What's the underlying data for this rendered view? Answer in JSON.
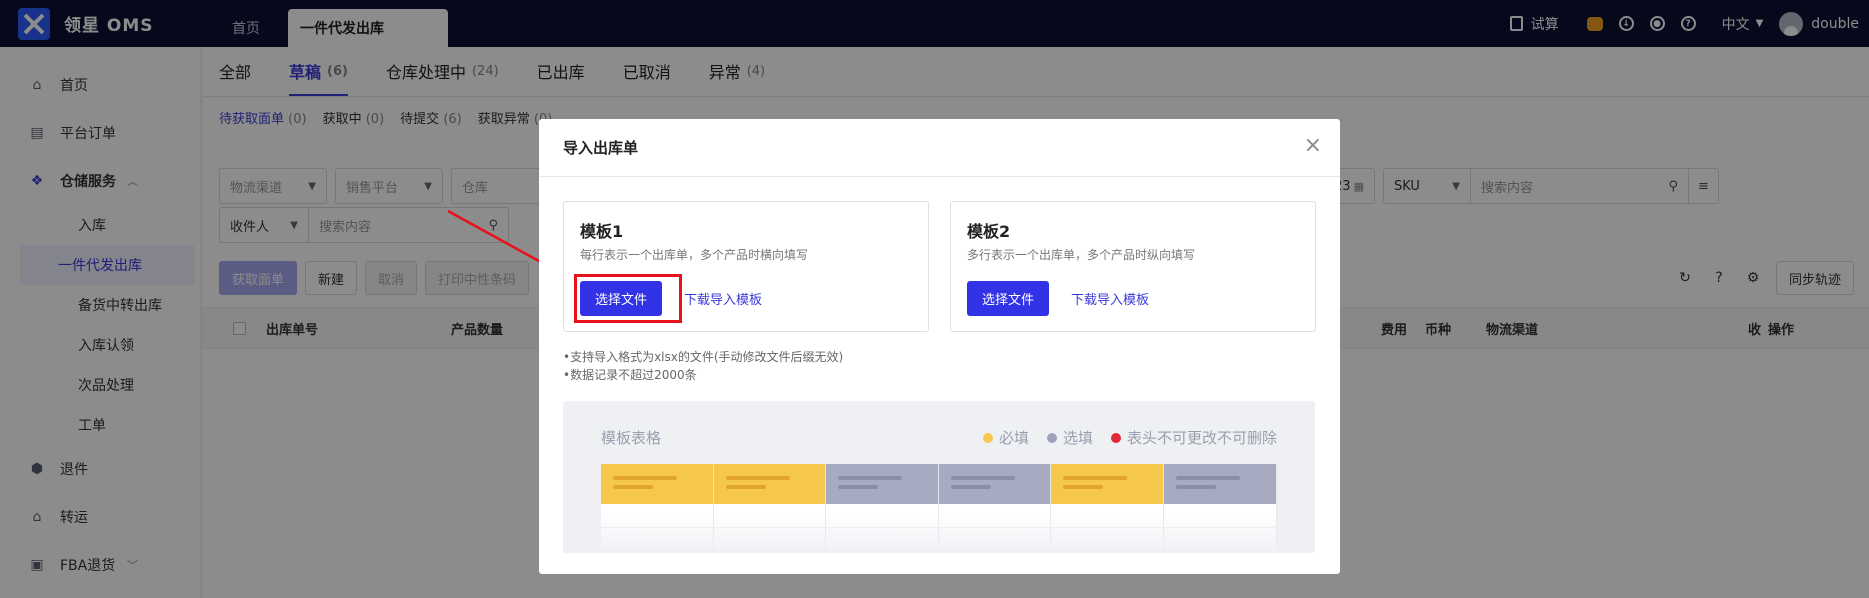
{
  "app": {
    "name": "领星 OMS",
    "user": "double",
    "language": "中文",
    "trial": "试算"
  },
  "top_tabs": [
    {
      "label": "首页"
    },
    {
      "label": "一件代发出库"
    }
  ],
  "sidebar": {
    "items": [
      {
        "label": "首页",
        "icon": "home-icon"
      },
      {
        "label": "平台订单",
        "icon": "order-icon"
      },
      {
        "label": "仓储服务",
        "icon": "warehouse-icon"
      },
      {
        "label": "退件",
        "icon": "return-icon"
      },
      {
        "label": "转运",
        "icon": "transfer-icon"
      },
      {
        "label": "FBA退货",
        "icon": "fba-icon"
      }
    ],
    "sub_items": [
      "入库",
      "一件代发出库",
      "备货中转出库",
      "入库认领",
      "次品处理",
      "工单"
    ]
  },
  "status_tabs": [
    {
      "label": "全部",
      "count": ""
    },
    {
      "label": "草稿",
      "count": "(6)"
    },
    {
      "label": "仓库处理中",
      "count": "(24)"
    },
    {
      "label": "已出库",
      "count": ""
    },
    {
      "label": "已取消",
      "count": ""
    },
    {
      "label": "异常",
      "count": "(4)"
    }
  ],
  "sub_tabs": [
    {
      "label": "待获取面单",
      "count": "(0)"
    },
    {
      "label": "获取中",
      "count": "(0)"
    },
    {
      "label": "待提交",
      "count": "(6)"
    },
    {
      "label": "获取异常",
      "count": "(0)"
    }
  ],
  "filters": {
    "logistics": "物流渠道",
    "platform": "销售平台",
    "warehouse": "仓库",
    "date_tail": "23",
    "sku": "SKU",
    "search_placeholder": "搜索内容",
    "receiver": "收件人"
  },
  "toolbar": {
    "get_label": "获取面单",
    "new": "新建",
    "cancel": "取消",
    "print": "打印中性条码",
    "sync": "同步轨迹"
  },
  "table_headers": {
    "order_no": "出库单号",
    "product_qty": "产品数量",
    "fee": "费用",
    "currency": "币种",
    "logistics": "物流渠道",
    "col_short": "收",
    "action": "操作"
  },
  "modal": {
    "title": "导入出库单",
    "templates": [
      {
        "name": "模板1",
        "desc": "每行表示一个出库单，多个产品时横向填写",
        "choose": "选择文件",
        "download": "下载导入模板"
      },
      {
        "name": "模板2",
        "desc": "多行表示一个出库单，多个产品时纵向填写",
        "choose": "选择文件",
        "download": "下载导入模板"
      }
    ],
    "notes": [
      "•支持导入格式为xlsx的文件(手动修改文件后缀无效)",
      "•数据记录不超过2000条"
    ],
    "preview": {
      "title": "模板表格",
      "legend": [
        {
          "label": "必填",
          "color": "#f5c84c"
        },
        {
          "label": "选填",
          "color": "#9ea2b8"
        },
        {
          "label": "表头不可更改不可删除",
          "color": "#e0283a"
        }
      ],
      "columns": [
        {
          "color": "#f5c84c",
          "line": "#e2a52c"
        },
        {
          "color": "#f5c84c",
          "line": "#e2a52c"
        },
        {
          "color": "#a7abc2",
          "line": "#8a8ea6"
        },
        {
          "color": "#a7abc2",
          "line": "#8a8ea6"
        },
        {
          "color": "#f5c84c",
          "line": "#e2a52c"
        },
        {
          "color": "#a7abc2",
          "line": "#8a8ea6"
        }
      ]
    }
  },
  "colors": {
    "primary": "#3232e6",
    "highlight": "#e8101a",
    "topbar": "#0b1033"
  }
}
